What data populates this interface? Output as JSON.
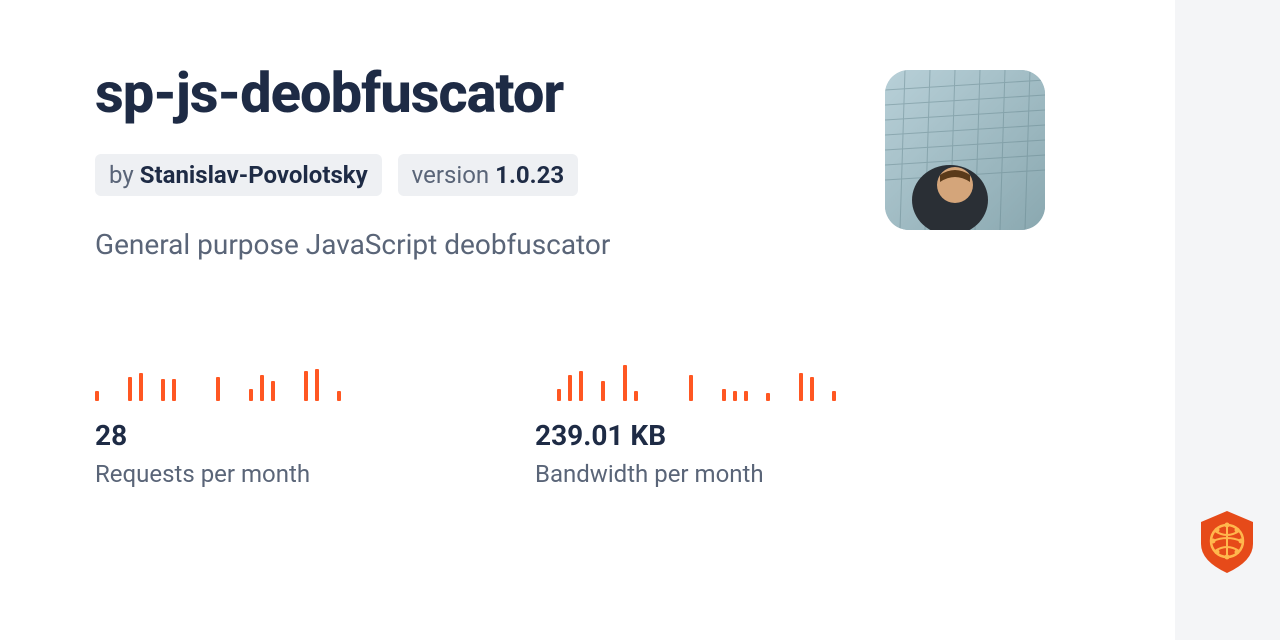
{
  "package": {
    "name": "sp-js-deobfuscator",
    "author_prefix": "by",
    "author": "Stanislav-Povolotsky",
    "version_prefix": "version",
    "version": "1.0.23",
    "description": "General purpose JavaScript deobfuscator"
  },
  "stats": {
    "requests": {
      "value": "28",
      "label": "Requests per month"
    },
    "bandwidth": {
      "value": "239.01 KB",
      "label": "Bandwidth per month"
    }
  },
  "chart_data": [
    {
      "type": "bar",
      "title": "Requests per month sparkline",
      "values": [
        10,
        0,
        0,
        24,
        28,
        0,
        22,
        22,
        0,
        0,
        0,
        24,
        0,
        0,
        12,
        26,
        20,
        0,
        0,
        30,
        32,
        0,
        10,
        0,
        0,
        0,
        0,
        0
      ],
      "ylim": [
        0,
        40
      ]
    },
    {
      "type": "bar",
      "title": "Bandwidth per month sparkline",
      "values": [
        0,
        0,
        12,
        26,
        30,
        0,
        20,
        0,
        36,
        10,
        0,
        0,
        0,
        0,
        26,
        0,
        0,
        12,
        10,
        10,
        0,
        8,
        0,
        0,
        28,
        24,
        0,
        10
      ],
      "ylim": [
        0,
        40
      ]
    }
  ],
  "colors": {
    "accent": "#ff5722",
    "text_primary": "#1e2b45",
    "text_secondary": "#5a6578",
    "badge_bg": "#eef0f3",
    "sidebar_bg": "#f4f5f7",
    "brand": "#e64a19"
  }
}
